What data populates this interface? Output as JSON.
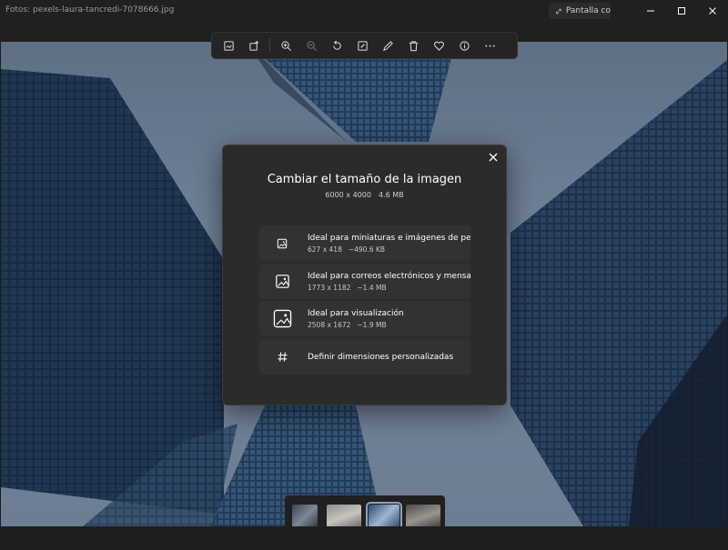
{
  "window": {
    "title": "Fotos: pexels-laura-tancredi-7078666.jpg",
    "fullscreen_label": "Pantalla co"
  },
  "toolbar": {
    "buttons": [
      {
        "name": "crop-icon"
      },
      {
        "name": "edit-image-icon"
      },
      {
        "name": "zoom-in-icon"
      },
      {
        "name": "zoom-out-icon"
      },
      {
        "name": "rotate-icon"
      },
      {
        "name": "edit-icon"
      },
      {
        "name": "draw-icon"
      },
      {
        "name": "delete-icon"
      },
      {
        "name": "favorite-icon"
      },
      {
        "name": "info-icon"
      },
      {
        "name": "more-icon"
      }
    ]
  },
  "dialog": {
    "title": "Cambiar el tamaño de la imagen",
    "dimensions": "6000 x 4000",
    "size": "4.6 MB",
    "options": [
      {
        "label": "Ideal para miniaturas e imágenes de perfil",
        "dims": "627 x 418",
        "size": "~490.6 KB",
        "icon": "image-small-icon"
      },
      {
        "label": "Ideal para correos electrónicos y mensajes",
        "dims": "1773 x 1182",
        "size": "~1.4 MB",
        "icon": "image-medium-icon"
      },
      {
        "label": "Ideal para visualización",
        "dims": "2508 x 1672",
        "size": "~1.9 MB",
        "icon": "image-large-icon"
      },
      {
        "label": "Definir dimensiones personalizadas",
        "icon": "hash-icon"
      }
    ]
  },
  "colors": {
    "accent": "#8fa3bf",
    "dialog_bg": "#2b2b2b",
    "option_bg": "#323232"
  }
}
